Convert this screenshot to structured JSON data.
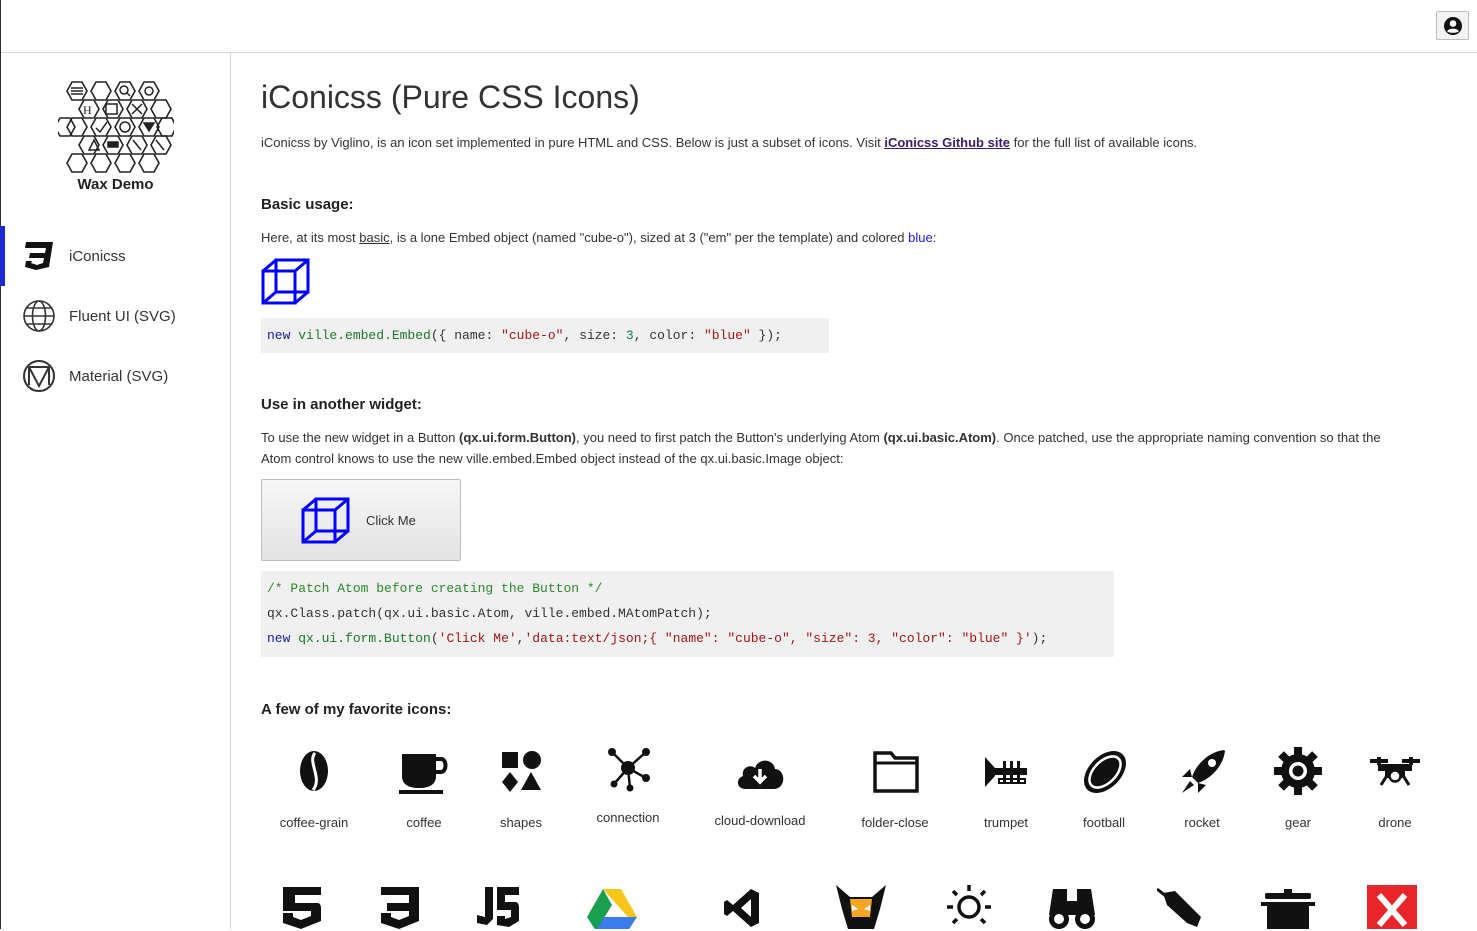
{
  "app": {
    "title": "Wax Demo"
  },
  "topbar": {
    "user_icon": "user-circle-icon"
  },
  "sidebar": {
    "items": [
      {
        "label": "iConicss",
        "icon": "css3-icon",
        "active": true
      },
      {
        "label": "Fluent UI (SVG)",
        "icon": "globe-icon",
        "active": false
      },
      {
        "label": "Material (SVG)",
        "icon": "material-icon",
        "active": false
      }
    ]
  },
  "page": {
    "title": "iConicss (Pure CSS Icons)",
    "intro_before": "iConicss by Viglino, is an icon set implemented in pure HTML and CSS. Below is just a subset of icons. Visit ",
    "intro_link": "iConicss Github site",
    "intro_after": " for the full list of available icons.",
    "basic": {
      "heading": "Basic usage:",
      "text_before": "Here, at its most ",
      "text_link": "basic",
      "text_middle": ", is a lone Embed object (named \"cube-o\"), sized at 3 (\"em\" per the template) and colored ",
      "text_color_word": "blue",
      "text_after": ":",
      "icon_color": "#0000ff"
    },
    "widget": {
      "heading": "Use in another widget:",
      "text_1": "To use the new widget in a Button ",
      "text_1b": "(qx.ui.form.Button)",
      "text_2": ", you need to first patch the Button's underlying Atom ",
      "text_2b": "(qx.ui.basic.Atom)",
      "text_3": ". Once patched, use the appropriate naming convention so that the",
      "text_4": "Atom control knows to use the new ville.embed.Embed object instead of the qx.ui.basic.Image object:",
      "button_label": "Click Me"
    },
    "favorites": {
      "heading": "A few of my favorite icons:",
      "row1": [
        "coffee-grain",
        "coffee",
        "shapes",
        "connection",
        "cloud-download",
        "folder-close",
        "trumpet",
        "football",
        "rocket",
        "gear",
        "drone"
      ]
    }
  },
  "code1": {
    "kw": "new",
    "cls": "ville.embed.Embed",
    "open": "({ ",
    "k1": "name: ",
    "v1": "\"cube-o\"",
    "sep1": ", ",
    "k2": "size: ",
    "v2": "3",
    "sep2": ", ",
    "k3": "color: ",
    "v3": "\"blue\"",
    "close": " });"
  },
  "code2": {
    "comment": "/* Patch Atom before creating the Button */",
    "line2": "qx.Class.patch(qx.ui.basic.Atom, ville.embed.MAtomPatch);",
    "kw": "new",
    "cls": "qx.ui.form.Button",
    "args_open": "(",
    "a1": "'Click Me'",
    "comma": ",",
    "a2": "'data:text/json;{ ",
    "k1": "\"name\"",
    "c1": ": ",
    "v1": "\"cube-o\"",
    "s1": ", ",
    "k2": "\"size\"",
    "c2": ": ",
    "v2": "3",
    "s2": ", ",
    "k3": "\"color\"",
    "c3": ": ",
    "v3": "\"blue\"",
    "end": " }'",
    "tail": ");"
  }
}
